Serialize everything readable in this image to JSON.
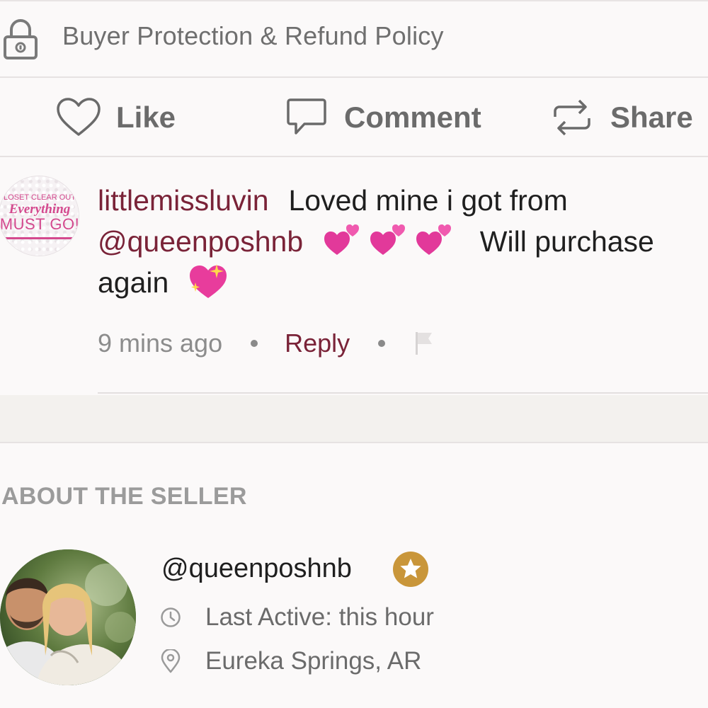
{
  "protection": {
    "text": "Buyer Protection & Refund Policy",
    "icon": "lock-icon"
  },
  "actions": {
    "like_label": "Like",
    "comment_label": "Comment",
    "share_label": "Share"
  },
  "comment": {
    "avatar_text": {
      "line1": "LOSET CLEAR OUT",
      "line2": "Everything",
      "line3": "MUST GO!"
    },
    "username": "littlemissluvin",
    "text_part1": "Loved mine i got from",
    "mention": "@queenposhnb",
    "text_part2": "Will purchase",
    "text_part3": "again",
    "time": "9 mins ago",
    "reply_label": "Reply"
  },
  "about": {
    "title": "ABOUT THE SELLER"
  },
  "seller": {
    "username": "@queenposhnb",
    "last_active": "Last Active: this hour",
    "location": "Eureka Springs, AR",
    "badge_color": "#c9963a"
  },
  "colors": {
    "accent_maroon": "#7a2338",
    "background": "#fbf9f9",
    "muted_text": "#6b6b6b"
  }
}
